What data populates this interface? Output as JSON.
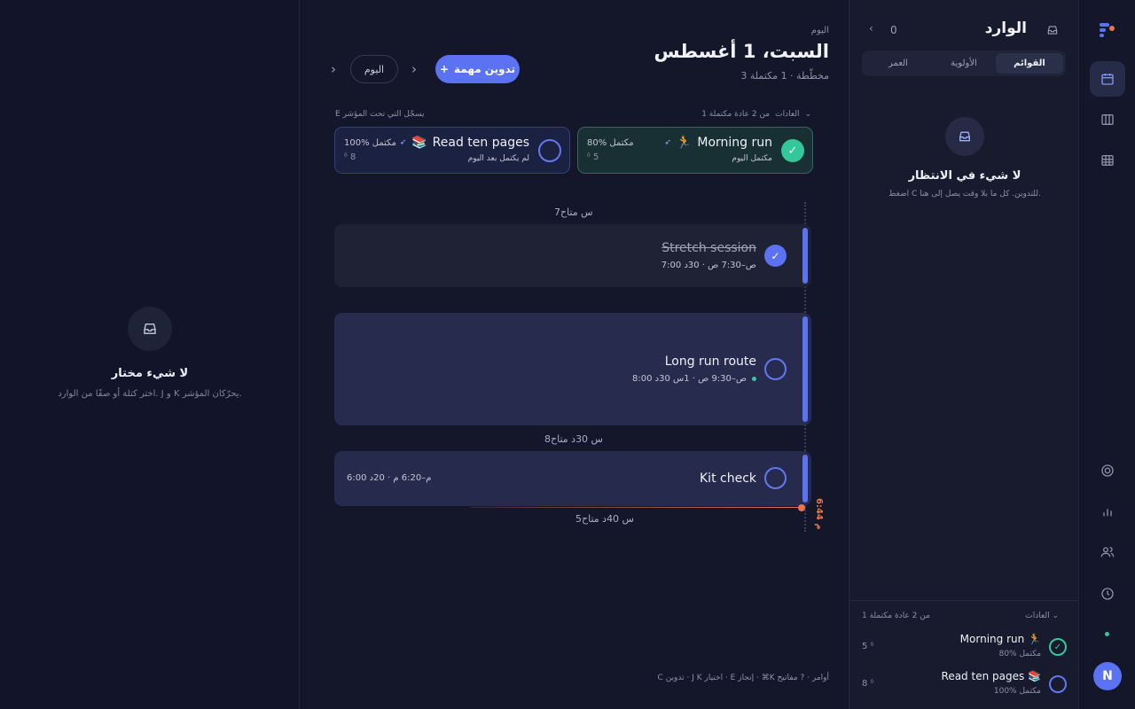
{
  "detail": {
    "empty_title": "لا شيء مختار",
    "empty_sub": "اختر كتلة أو صفًا من الوارد. J و K يحرّكان المؤشر."
  },
  "header": {
    "date_label": "اليوم",
    "date_title": "السبت، 1 أغسطس",
    "meta": "3 مخطّطة · 1 مكتملة",
    "add_button": "تدوين مهمة",
    "today_button": "اليوم"
  },
  "habits": {
    "head_label": "العادات",
    "head_count": "1 من 2 عادة مكتملة",
    "hint": "E يسجّل التي تحت المؤشر",
    "items": [
      {
        "name": "Morning run",
        "emoji": "🏃",
        "status": "مكتمل اليوم",
        "pct": "80% مكتمل",
        "count": "5",
        "done": true
      },
      {
        "name": "Read ten pages",
        "emoji": "📚",
        "status": "لم يكتمل بعد اليوم",
        "pct": "100% مكتمل",
        "count": "8",
        "done": false
      }
    ]
  },
  "timeline": {
    "gap1": "7س متاح",
    "gap2": "8س 30د متاح",
    "gap3": "5س 40د متاح",
    "now": "6:44 م",
    "blocks": [
      {
        "title": "Stretch session",
        "time": "7:00 ص–7:30 ص · 30د",
        "done": true
      },
      {
        "title": "Long run route",
        "time": "8:00 ص–9:30 ص · 1س 30د",
        "done": false
      },
      {
        "title": "Kit check",
        "time": "6:00 م–6:20 م · 20د",
        "done": false
      }
    ]
  },
  "shortcuts": "C تدوين · J K اختيار · E إنجاز · ⌘K أوامر · ? مفاتيح",
  "inbox": {
    "title": "الوارد",
    "count": "0",
    "tabs": [
      "القوائم",
      "الأولوية",
      "العمر"
    ],
    "empty_title": "لا شيء في الانتظار",
    "empty_sub": "اضغط C للتدوين. كل ما بلا وقت يصل إلى هنا.",
    "habit_head": "العادات",
    "habit_count": "1 من 2 عادة مكتملة",
    "habits": [
      {
        "name": "Morning run",
        "emoji": "🏃",
        "pct": "80% مكتمل",
        "count": "5"
      },
      {
        "name": "Read ten pages",
        "emoji": "📚",
        "pct": "100% مكتمل",
        "count": "8"
      }
    ]
  },
  "user": {
    "initial": "N"
  },
  "colors": {
    "accent": "#5b72f2",
    "success": "#34c79a",
    "now": "#e5784a",
    "bg": "#14172a"
  }
}
